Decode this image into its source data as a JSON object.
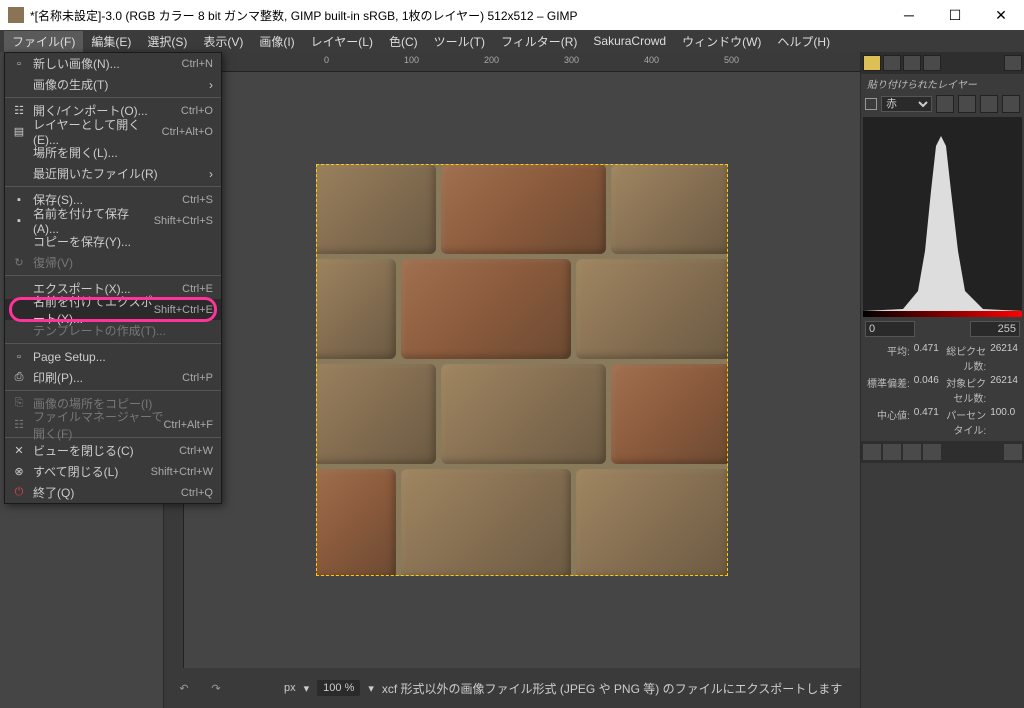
{
  "window": {
    "title": "*[名称未設定]-3.0 (RGB カラー 8 bit ガンマ整数, GIMP built-in sRGB, 1枚のレイヤー) 512x512 – GIMP"
  },
  "menubar": {
    "items": [
      {
        "label": "ファイル(F)",
        "active": true
      },
      {
        "label": "編集(E)"
      },
      {
        "label": "選択(S)"
      },
      {
        "label": "表示(V)"
      },
      {
        "label": "画像(I)"
      },
      {
        "label": "レイヤー(L)"
      },
      {
        "label": "色(C)"
      },
      {
        "label": "ツール(T)"
      },
      {
        "label": "フィルター(R)"
      },
      {
        "label": "SakuraCrowd"
      },
      {
        "label": "ウィンドウ(W)"
      },
      {
        "label": "ヘルプ(H)"
      }
    ]
  },
  "filemenu": {
    "new": {
      "label": "新しい画像(N)...",
      "shortcut": "Ctrl+N"
    },
    "create": {
      "label": "画像の生成(T)"
    },
    "open": {
      "label": "開く/インポート(O)...",
      "shortcut": "Ctrl+O"
    },
    "open_as_layer": {
      "label": "レイヤーとして開く(E)...",
      "shortcut": "Ctrl+Alt+O"
    },
    "open_location": {
      "label": "場所を開く(L)..."
    },
    "recent": {
      "label": "最近開いたファイル(R)"
    },
    "save": {
      "label": "保存(S)...",
      "shortcut": "Ctrl+S"
    },
    "save_as": {
      "label": "名前を付けて保存(A)...",
      "shortcut": "Shift+Ctrl+S"
    },
    "save_copy": {
      "label": "コピーを保存(Y)..."
    },
    "revert": {
      "label": "復帰(V)"
    },
    "export": {
      "label": "エクスポート(X)...",
      "shortcut": "Ctrl+E"
    },
    "export_as": {
      "label": "名前を付けてエクスポート(X)...",
      "shortcut": "Shift+Ctrl+E"
    },
    "create_template": {
      "label": "テンプレートの作成(T)..."
    },
    "page_setup": {
      "label": "Page Setup..."
    },
    "print": {
      "label": "印刷(P)...",
      "shortcut": "Ctrl+P"
    },
    "copy_location": {
      "label": "画像の場所をコピー(I)"
    },
    "show_in_fm": {
      "label": "ファイルマネージャーで開く(F)",
      "shortcut": "Ctrl+Alt+F"
    },
    "close_view": {
      "label": "ビューを閉じる(C)",
      "shortcut": "Ctrl+W"
    },
    "close_all": {
      "label": "すべて閉じる(L)",
      "shortcut": "Shift+Ctrl+W"
    },
    "quit": {
      "label": "終了(Q)",
      "shortcut": "Ctrl+Q"
    }
  },
  "ruler": {
    "marks": [
      "0",
      "100",
      "200",
      "300",
      "400",
      "500"
    ]
  },
  "status": {
    "unit": "px",
    "zoom": "100 %",
    "hint": "xcf 形式以外の画像ファイル形式 (JPEG や PNG 等) のファイルにエクスポートします"
  },
  "right": {
    "layer_caption": "貼り付けられたレイヤー",
    "channel": "赤",
    "histo": {
      "min": "0",
      "max": "255"
    },
    "stats": {
      "mean_lbl": "平均:",
      "mean": "0.471",
      "std_lbl": "標準偏差:",
      "std": "0.046",
      "median_lbl": "中心値:",
      "median": "0.471",
      "pixels_lbl": "総ピクセル数:",
      "pixels": "26214",
      "sel_lbl": "対象ピクセル数:",
      "sel": "26214",
      "pct_lbl": "パーセンタイル:",
      "pct": "100.0"
    }
  }
}
